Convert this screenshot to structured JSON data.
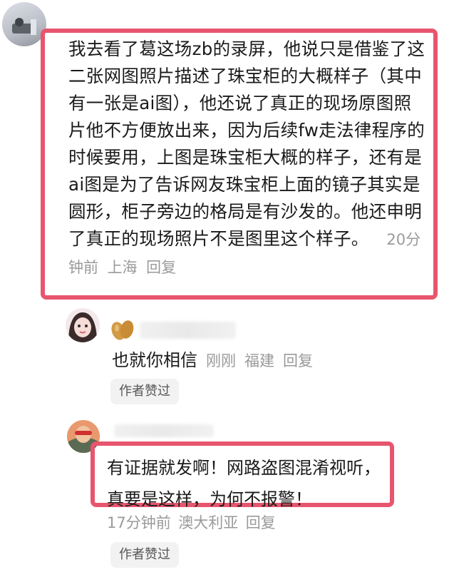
{
  "comment": {
    "text": "我去看了葛这场zb的录屏，他说只是借鉴了这二张网图照片描述了珠宝柜的大概样子（其中有一张是ai图），他还说了真正的现场原图照片他不方便放出来，因为后续fw走法律程序的时候要用，上图是珠宝柜大概的样子，还有是ai图是为了告诉网友珠宝柜上面的镜子其实是圆形，柜子旁边的格局是有沙发的。他还申明了真正的现场照片不是图里这个样子。",
    "time": "20分钟前",
    "location": "上海",
    "reply_label": "回复"
  },
  "replies": [
    {
      "text": "也就你相信",
      "time": "刚刚",
      "location": "福建",
      "reply_label": "回复",
      "author_liked": "作者赞过"
    },
    {
      "text": "有证据就发啊！网路盗图混淆视听，真要是这样，为何不报警！",
      "time": "17分钟前",
      "location": "澳大利亚",
      "reply_label": "回复",
      "author_liked": "作者赞过"
    }
  ],
  "colors": {
    "highlight_border": "#e8556e",
    "meta_text": "#9a9a9a",
    "tag_bg": "#f2f2f2"
  },
  "icons": {
    "reply1_badge": "peanut-icon"
  }
}
